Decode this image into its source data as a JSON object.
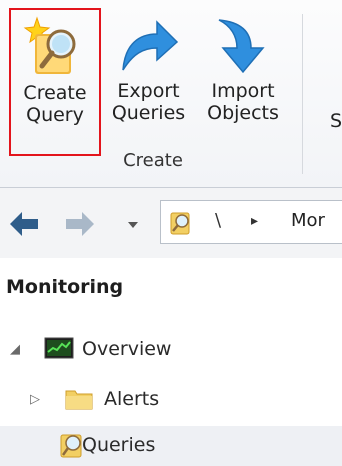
{
  "ribbon": {
    "create_query": "Create\nQuery",
    "export_queries": "Export\nQueries",
    "import_objects": "Import\nObjects",
    "group_label": "Create",
    "clipped_label": "S"
  },
  "address_bar": {
    "separator": "\\",
    "arrow": "▸",
    "segment": "Mor"
  },
  "nav": {
    "title": "Monitoring",
    "items": [
      {
        "label": "Overview",
        "expand": "◢"
      },
      {
        "label": "Alerts",
        "expand": "▷"
      },
      {
        "label": "Queries",
        "expand": ""
      }
    ]
  },
  "colors": {
    "highlight_border": "#e3141c",
    "accent_blue": "#2f8fde",
    "folder": "#f2cf63"
  }
}
